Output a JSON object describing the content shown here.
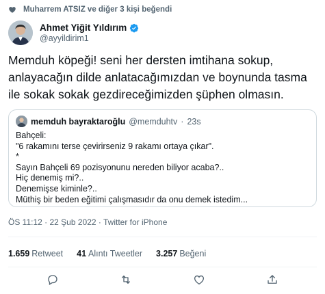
{
  "social_context": {
    "text": "Muharrem ATSIZ ve diğer 3 kişi beğendi",
    "icon": "heart-icon"
  },
  "author": {
    "name": "Ahmet Yiğit Yıldırım",
    "handle": "@ayyildirim1",
    "verified": true
  },
  "tweet_text": "Memduh köpeği! seni her dersten imtihana sokup, anlayacağın dilde anlatacağımızdan ve boynunda tasma ile sokak sokak gezdireceğimizden şüphen olmasın.",
  "quote": {
    "name": "memduh bayraktaroğlu",
    "handle": "@memduhtv",
    "separator": "·",
    "time": "23s",
    "lines": [
      "Bahçeli:",
      "\"6 rakamını terse çevirirseniz 9 rakamı ortaya çıkar\".",
      "*",
      "Sayın Bahçeli 69 pozisyonunu nereden biliyor acaba?..",
      "Hiç denemiş mi?..",
      "Denemişse kiminle?..",
      "Müthiş bir beden eğitimi çalışmasıdır da onu demek istedim..."
    ]
  },
  "meta": {
    "time": "ÖS 11:12",
    "separator1": " · ",
    "date": "22 Şub 2022",
    "separator2": " · ",
    "app": "Twitter for iPhone"
  },
  "stats": {
    "retweets_count": "1.659",
    "retweets_label": "Retweet",
    "quotes_count": "41",
    "quotes_label": "Alıntı Tweetler",
    "likes_count": "3.257",
    "likes_label": "Beğeni"
  },
  "actions": [
    "reply-icon",
    "retweet-icon",
    "like-icon",
    "share-icon"
  ],
  "colors": {
    "text": "#0f1419",
    "secondary": "#536471",
    "border": "#cfd9de",
    "verified": "#1d9bf0"
  }
}
